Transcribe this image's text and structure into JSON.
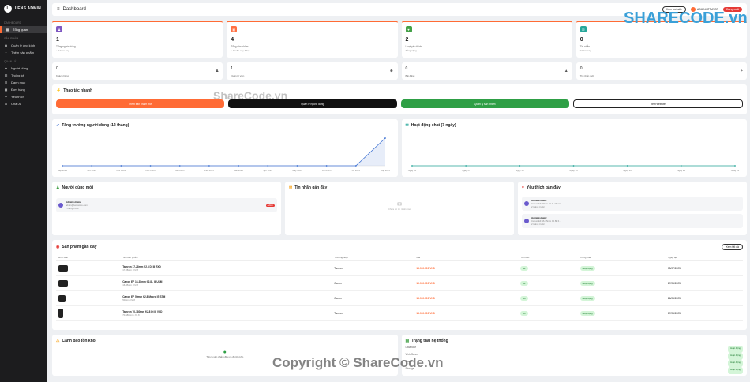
{
  "brand": {
    "name": "LENS ADMIN",
    "logo": "L"
  },
  "sidebar": {
    "sections": [
      {
        "title": "Dashboard",
        "items": [
          {
            "label": "Tổng quan",
            "icon": "grid-icon",
            "active": true
          }
        ]
      },
      {
        "title": "Sản phẩm",
        "items": [
          {
            "label": "Quản lý ống kính",
            "icon": "camera-icon"
          },
          {
            "label": "Thêm sản phẩm",
            "icon": "plus-icon"
          }
        ]
      },
      {
        "title": "Quản lý",
        "items": [
          {
            "label": "Người dùng",
            "icon": "users-icon"
          },
          {
            "label": "Thống kê",
            "icon": "chart-icon"
          },
          {
            "label": "Danh mục",
            "icon": "list-icon"
          },
          {
            "label": "Đơn hàng",
            "icon": "cart-icon"
          },
          {
            "label": "Yêu thích",
            "icon": "heart-icon"
          },
          {
            "label": "Chat AI",
            "icon": "chat-icon"
          }
        ]
      }
    ]
  },
  "topbar": {
    "title": "Dashboard",
    "view_site": "Xem website",
    "user": "ADMINISTRATOR",
    "logout": "Đăng xuất"
  },
  "stats": [
    {
      "value": "1",
      "label": "Tổng người dùng",
      "sub": "+ 0 hôm nay",
      "color": "#7e57c2",
      "icon": "user-icon"
    },
    {
      "value": "4",
      "label": "Tổng sản phẩm",
      "sub": "+ 0 tuần này đăng",
      "color": "#ff7043",
      "icon": "box-icon"
    },
    {
      "value": "2",
      "label": "Lượt yêu thích",
      "sub": "Tổng cộng",
      "color": "#43a047",
      "icon": "heart-icon"
    },
    {
      "value": "0",
      "label": "Tin nhắn",
      "sub": "0 hôm nay",
      "color": "#26a69a",
      "icon": "chat-icon"
    }
  ],
  "mini_stats": [
    {
      "value": "0",
      "label": "Khách hàng",
      "icon": "user-icon"
    },
    {
      "value": "1",
      "label": "Quản trị viên",
      "icon": "users-icon"
    },
    {
      "value": "0",
      "label": "Bài đăng",
      "icon": "upload-icon"
    },
    {
      "value": "0",
      "label": "Tin nhắn mới",
      "icon": "plus-icon"
    }
  ],
  "quick": {
    "title": "Thao tác nhanh",
    "buttons": [
      {
        "label": "Thêm sản phẩm mới",
        "bg": "#ff6b35"
      },
      {
        "label": "Quản lý người dùng",
        "bg": "#111111"
      },
      {
        "label": "Quản lý sản phẩm",
        "bg": "#2e9f45"
      },
      {
        "label": "Xem website",
        "bg": "#ffffff"
      }
    ]
  },
  "chart_data": [
    {
      "type": "line",
      "title": "Tăng trưởng người dùng (12 tháng)",
      "categories": [
        "Sep 2024",
        "Oct 2024",
        "Nov 2024",
        "Dec 2024",
        "Jan 2025",
        "Feb 2025",
        "Mar 2025",
        "Apr 2025",
        "May 2025",
        "Jun 2025",
        "Jul 2025",
        "Aug 2025"
      ],
      "values": [
        0,
        0,
        0,
        0,
        0,
        0,
        0,
        0,
        0,
        0,
        0,
        1
      ],
      "ylim": [
        0,
        1.2
      ],
      "color": "#3b6fd1"
    },
    {
      "type": "line",
      "title": "Hoạt động chat (7 ngày)",
      "categories": [
        "Ngày 16",
        "Ngày 17",
        "Ngày 18",
        "Ngày 19",
        "Ngày 20",
        "Ngày 21",
        "Ngày 22"
      ],
      "values": [
        0,
        0,
        0,
        0,
        0,
        0,
        0
      ],
      "ylim": [
        0,
        1
      ],
      "color": "#26a69a"
    }
  ],
  "new_users": {
    "title": "Người dùng mới",
    "items": [
      {
        "name": "Administrator",
        "email": "admin@lensstore.com",
        "date": "2 tháng trước",
        "badge": "Admin"
      }
    ]
  },
  "recent_msgs": {
    "title": "Tin nhắn gần đây",
    "empty": "Chưa có tin nhắn nào"
  },
  "recent_favs": {
    "title": "Yêu thích gần đây",
    "items": [
      {
        "name": "Administrator",
        "product": "Canon EF 50mm f/1.2L Macro...",
        "date": "2 tháng trước"
      },
      {
        "name": "Administrator",
        "product": "Canon EF 16-35mm f/2.8L II...",
        "date": "2 tháng trước"
      }
    ]
  },
  "products": {
    "title": "Sản phẩm gần đây",
    "view_all": "Xem tất cả",
    "headers": [
      "Hình ảnh",
      "Tên sản phẩm",
      "Thương hiệu",
      "Giá",
      "Tồn kho",
      "Trạng thái",
      "Ngày tạo"
    ],
    "rows": [
      {
        "name": "Tamron 17-28mm f/2.8 Di III RXD",
        "sub": "17-28mm • f/2.8",
        "brand": "Tamron",
        "price": "18.900.000 VNĐ",
        "stock": "32",
        "status": "Hoạt động",
        "date": "05/07/2025"
      },
      {
        "name": "Canon EF 16-35mm f/2.8L III USM",
        "sub": "16-35mm • f/2.8",
        "brand": "Canon",
        "price": "16.900.000 VNĐ",
        "stock": "22",
        "status": "Hoạt động",
        "date": "27/06/2025"
      },
      {
        "name": "Canon EF 50mm f/2.8 Macro IS STM",
        "sub": "50mm • f/2.8",
        "brand": "Canon",
        "price": "18.900.000 VNĐ",
        "stock": "18",
        "status": "Hoạt động",
        "date": "26/06/2025"
      },
      {
        "name": "Tamron 70-180mm f/2.8 Di III VXD",
        "sub": "70-180mm • f/2.8",
        "brand": "Tamron",
        "price": "18.900.000 VNĐ",
        "stock": "20",
        "status": "Hoạt động",
        "date": "17/06/2025"
      }
    ]
  },
  "stock_alert": {
    "title": "Cảnh báo tồn kho",
    "empty": "Tất cả sản phẩm đều có đủ tồn kho"
  },
  "system": {
    "title": "Trạng thái hệ thống",
    "rows": [
      {
        "label": "Database",
        "status": "Hoạt động"
      },
      {
        "label": "Web Server",
        "status": "Hoạt động"
      },
      {
        "label": "Cache",
        "status": "Hoạt động"
      },
      {
        "label": "Storage",
        "status": "Hoạt động"
      }
    ]
  },
  "watermarks": {
    "top": "SHARECODE.vn",
    "mid": "ShareCode.vn",
    "bottom": "Copyright © ShareCode.vn"
  }
}
